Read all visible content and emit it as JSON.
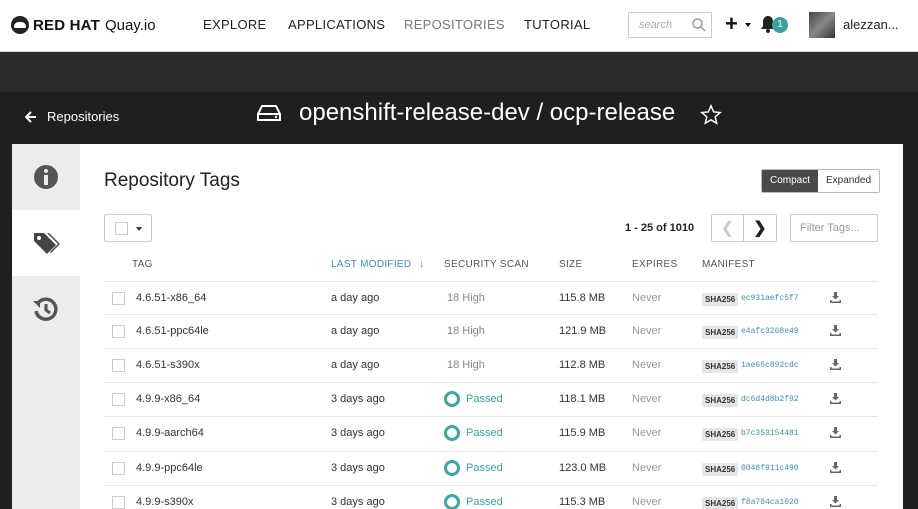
{
  "brand": {
    "name": "RED HAT",
    "product": "Quay.io"
  },
  "nav": {
    "explore": "EXPLORE",
    "applications": "APPLICATIONS",
    "repositories": "REPOSITORIES",
    "tutorial": "TUTORIAL"
  },
  "search": {
    "placeholder": "search"
  },
  "notifications": {
    "count": "1"
  },
  "user": {
    "name": "alezzan..."
  },
  "header": {
    "back_label": "Repositories",
    "repo_title": "openshift-release-dev / ocp-release"
  },
  "tags": {
    "title": "Repository Tags",
    "view_compact": "Compact",
    "view_expanded": "Expanded",
    "view_selected": "Compact",
    "pagination": "1 - 25 of 1010",
    "filter_placeholder": "Filter Tags...",
    "columns": {
      "tag": "TAG",
      "last_modified": "LAST MODIFIED",
      "security_scan": "SECURITY SCAN",
      "size": "SIZE",
      "expires": "EXPIRES",
      "manifest": "MANIFEST"
    },
    "sort_column": "LAST MODIFIED",
    "rows": [
      {
        "tag": "4.6.51-x86_64",
        "modified": "a day ago",
        "scan": "18 High",
        "scan_status": "high",
        "size": "115.8 MB",
        "expires": "Never",
        "algo": "SHA256",
        "digest": "ec931aefc5f7"
      },
      {
        "tag": "4.6.51-ppc64le",
        "modified": "a day ago",
        "scan": "18 High",
        "scan_status": "high",
        "size": "121.9 MB",
        "expires": "Never",
        "algo": "SHA256",
        "digest": "e4afc3268e49"
      },
      {
        "tag": "4.6.51-s390x",
        "modified": "a day ago",
        "scan": "18 High",
        "scan_status": "high",
        "size": "112.8 MB",
        "expires": "Never",
        "algo": "SHA256",
        "digest": "1ae65c892cdc"
      },
      {
        "tag": "4.9.9-x86_64",
        "modified": "3 days ago",
        "scan": "Passed",
        "scan_status": "passed",
        "size": "118.1 MB",
        "expires": "Never",
        "algo": "SHA256",
        "digest": "dc6d4d8b2f92"
      },
      {
        "tag": "4.9.9-aarch64",
        "modified": "3 days ago",
        "scan": "Passed",
        "scan_status": "passed",
        "size": "115.9 MB",
        "expires": "Never",
        "algo": "SHA256",
        "digest": "b7c353154481"
      },
      {
        "tag": "4.9.9-ppc64le",
        "modified": "3 days ago",
        "scan": "Passed",
        "scan_status": "passed",
        "size": "123.0 MB",
        "expires": "Never",
        "algo": "SHA256",
        "digest": "0048f911c490"
      },
      {
        "tag": "4.9.9-s390x",
        "modified": "3 days ago",
        "scan": "Passed",
        "scan_status": "passed",
        "size": "115.3 MB",
        "expires": "Never",
        "algo": "SHA256",
        "digest": "f8a784ca1020"
      }
    ]
  },
  "icons": [
    "search-icon",
    "plus-icon",
    "bell-icon",
    "back-arrow-icon",
    "drive-icon",
    "star-icon",
    "info-icon",
    "tags-icon",
    "history-icon",
    "download-icon"
  ],
  "colors": {
    "accent": "#3aa6a6",
    "link": "#3a8fb7",
    "header_dark": "#1f1f1f"
  }
}
